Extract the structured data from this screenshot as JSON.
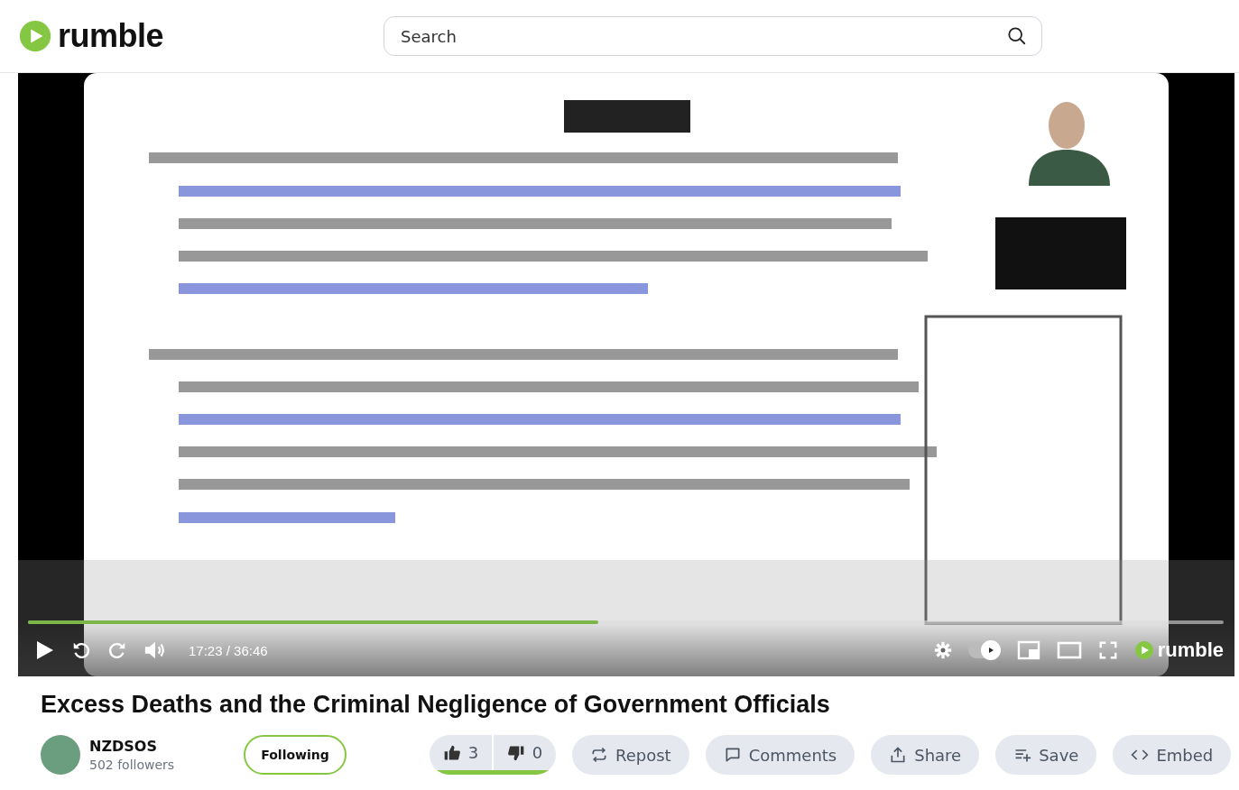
{
  "header": {
    "logo": "rumble",
    "search": {
      "placeholder": "Search"
    }
  },
  "player": {
    "kind": "picture",
    "progress": {
      "level": 0.477
    },
    "playing": false,
    "time": "17:23 / 36:46",
    "autoplay": true,
    "logo": "rumble"
  },
  "video": {
    "title": "Excess Deaths and the Criminal Negligence of Government Officials"
  },
  "channel": {
    "name": "NZDSOS",
    "followers": "502 followers",
    "follow_button": {
      "label": "Following",
      "selected": true
    }
  },
  "rating": {
    "likes": "3",
    "dislikes": "0",
    "level": 1
  },
  "actions": [
    {
      "label": "Repost",
      "kind": "repost"
    },
    {
      "label": "Comments",
      "kind": "comments"
    },
    {
      "label": "Share",
      "kind": "share"
    },
    {
      "label": "Save",
      "kind": "save"
    },
    {
      "label": "Embed",
      "kind": "embed"
    }
  ]
}
